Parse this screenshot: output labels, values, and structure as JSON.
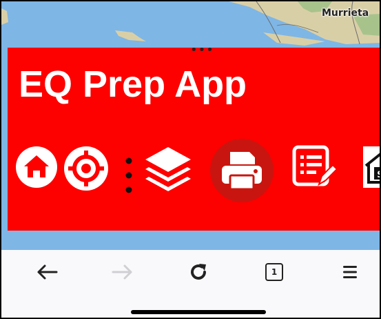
{
  "map": {
    "place_label": "Murrieta"
  },
  "app": {
    "title": "EQ Prep App",
    "handle": "•••",
    "accent_color": "#fd0000",
    "active_tool_color": "#c9150f"
  },
  "toolbar": {
    "tools": [
      {
        "icon": "home-icon",
        "label": "Home"
      },
      {
        "icon": "locate-icon",
        "label": "Locate"
      },
      {
        "icon": "more-vertical-icon",
        "label": "More"
      },
      {
        "icon": "layers-icon",
        "label": "Layers"
      },
      {
        "icon": "print-icon",
        "label": "Print",
        "active": true
      },
      {
        "icon": "edit-list-icon",
        "label": "Edit"
      },
      {
        "icon": "house-dollar-icon",
        "label": "Property"
      }
    ]
  },
  "browser": {
    "tab_count": "1",
    "icons": [
      "back-arrow-icon",
      "forward-arrow-icon",
      "reload-icon",
      "tabs-icon",
      "menu-icon"
    ]
  }
}
